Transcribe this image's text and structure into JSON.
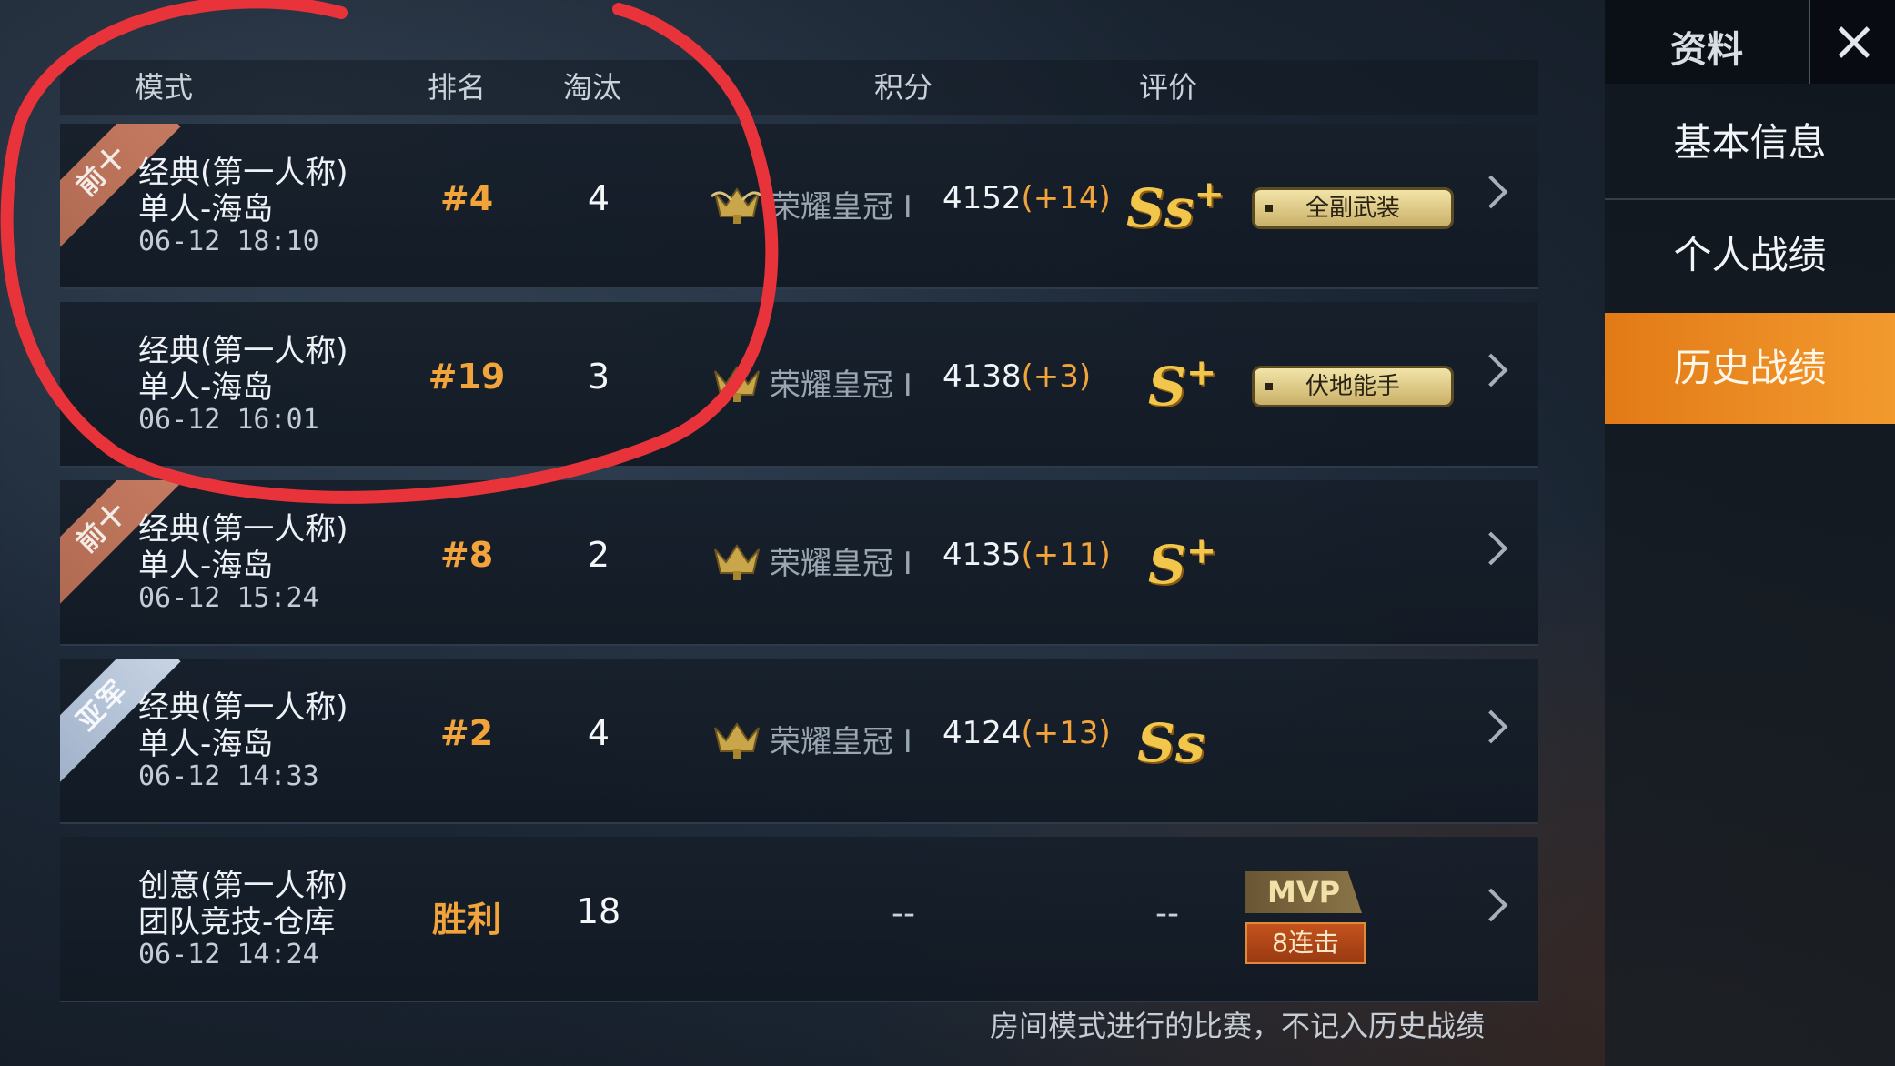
{
  "header": {
    "mode": "模式",
    "rank": "排名",
    "kills": "淘汰",
    "score": "积分",
    "rating": "评价"
  },
  "rows": [
    {
      "ribbon": "前十",
      "mode_line1": "经典(第一人称)",
      "mode_line2": "单人-海岛",
      "time": "06-12 18:10",
      "rank": "#4",
      "kills": "4",
      "tier": "荣耀皇冠 I",
      "points": "4152",
      "delta": "(+14)",
      "grade": "Ss",
      "grade_plus": "+",
      "tag": "全副武装"
    },
    {
      "ribbon": "",
      "mode_line1": "经典(第一人称)",
      "mode_line2": "单人-海岛",
      "time": "06-12 16:01",
      "rank": "#19",
      "kills": "3",
      "tier": "荣耀皇冠 I",
      "points": "4138",
      "delta": "(+3)",
      "grade": "S",
      "grade_plus": "+",
      "tag": "伏地能手"
    },
    {
      "ribbon": "前十",
      "mode_line1": "经典(第一人称)",
      "mode_line2": "单人-海岛",
      "time": "06-12 15:24",
      "rank": "#8",
      "kills": "2",
      "tier": "荣耀皇冠 I",
      "points": "4135",
      "delta": "(+11)",
      "grade": "S",
      "grade_plus": "+",
      "tag": ""
    },
    {
      "ribbon": "亚军",
      "mode_line1": "经典(第一人称)",
      "mode_line2": "单人-海岛",
      "time": "06-12 14:33",
      "rank": "#2",
      "kills": "4",
      "tier": "荣耀皇冠 I",
      "points": "4124",
      "delta": "(+13)",
      "grade": "Ss",
      "grade_plus": "",
      "tag": ""
    },
    {
      "ribbon": "",
      "mode_line1": "创意(第一人称)",
      "mode_line2": "团队竞技-仓库",
      "time": "06-12 14:24",
      "rank": "胜利",
      "kills": "18",
      "score_dash": "--",
      "rating_dash": "--",
      "mvp": "MVP",
      "streak": "8连击"
    }
  ],
  "footnote": "房间模式进行的比赛，不记入历史战绩",
  "panel": {
    "title": "资料",
    "nav": [
      "基本信息",
      "个人战绩",
      "历史战绩"
    ],
    "active_index": 2
  },
  "colors": {
    "accent": "#f29a2e",
    "rank": "#f2a43a",
    "grade": "#f2c64a",
    "annotation": "#e8333a"
  },
  "icons": [
    "crown-icon",
    "chevron-right-icon",
    "close-icon"
  ]
}
